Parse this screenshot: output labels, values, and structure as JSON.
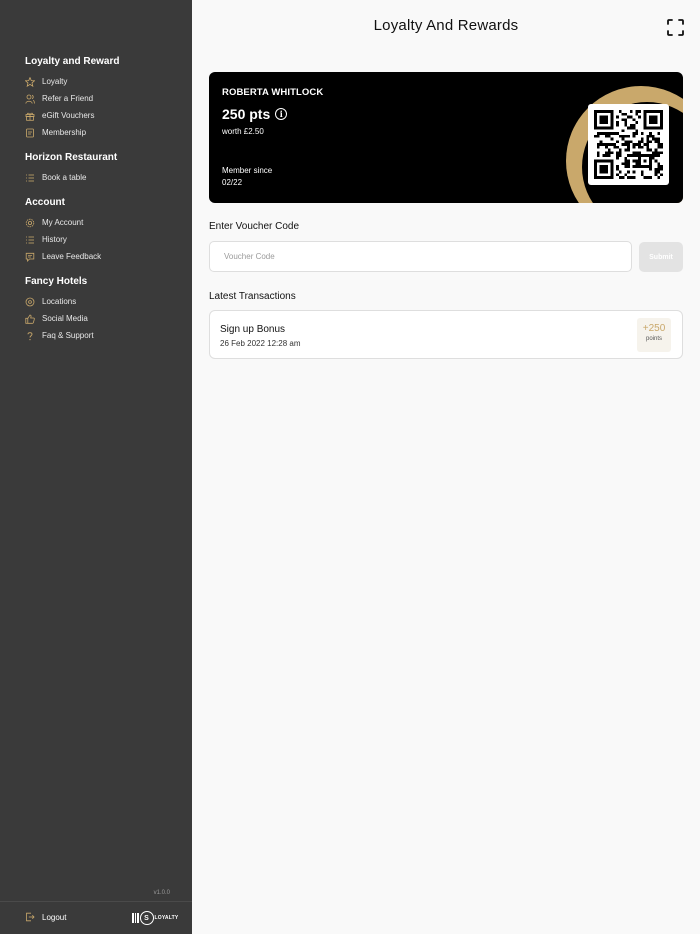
{
  "header": {
    "title": "Loyalty And Rewards",
    "expand_icon": "expand-icon"
  },
  "sidebar": {
    "sections": [
      {
        "title": "Loyalty and Reward",
        "items": [
          {
            "label": "Loyalty",
            "icon": "star-icon"
          },
          {
            "label": "Refer a Friend",
            "icon": "user-icon"
          },
          {
            "label": "eGift Vouchers",
            "icon": "gift-icon"
          },
          {
            "label": "Membership",
            "icon": "card-icon"
          }
        ]
      },
      {
        "title": "Horizon Restaurant",
        "items": [
          {
            "label": "Book a table",
            "icon": "list-icon"
          }
        ]
      },
      {
        "title": "Account",
        "items": [
          {
            "label": "My Account",
            "icon": "gear-icon"
          },
          {
            "label": "History",
            "icon": "list-icon"
          },
          {
            "label": "Leave Feedback",
            "icon": "feedback-icon"
          }
        ]
      },
      {
        "title": "Fancy Hotels",
        "items": [
          {
            "label": "Locations",
            "icon": "location-pin-icon"
          },
          {
            "label": "Social Media",
            "icon": "thumbs-up-icon"
          },
          {
            "label": "Faq & Support",
            "icon": "question-icon"
          }
        ]
      }
    ],
    "version": "v1.0.0",
    "logout_label": "Logout",
    "brand": {
      "letter": "S",
      "text": "LOYALTY"
    }
  },
  "card": {
    "name": "ROBERTA WHITLOCK",
    "points": "250 pts",
    "worth": "worth £2.50",
    "member_since_label": "Member since",
    "member_since": "02/22",
    "accent_color": "#c9a86b"
  },
  "voucher": {
    "label": "Enter Voucher Code",
    "placeholder": "Voucher Code",
    "value": "",
    "submit_label": "Submit"
  },
  "transactions": {
    "label": "Latest Transactions",
    "items": [
      {
        "title": "Sign up Bonus",
        "date": "26 Feb 2022 12:28 am",
        "amount": "+250",
        "unit": "points"
      }
    ]
  }
}
